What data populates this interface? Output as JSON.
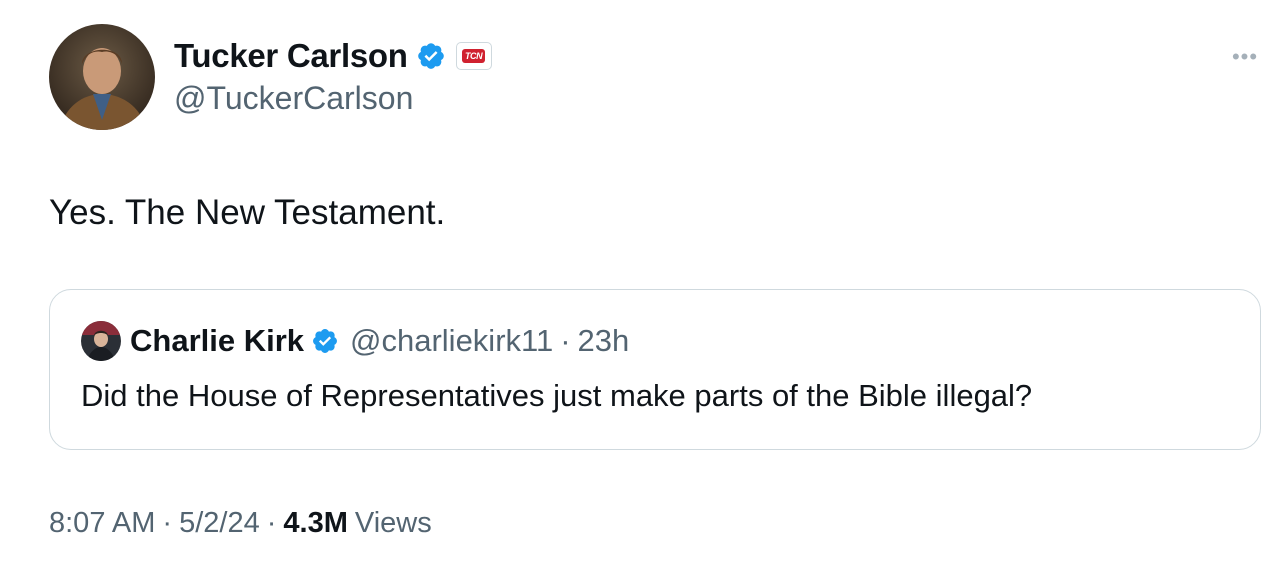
{
  "tweet": {
    "author": {
      "display_name": "Tucker Carlson",
      "handle": "@TuckerCarlson",
      "verified": true,
      "affiliation_badge": "TCN"
    },
    "more_icon": "more-horizontal-icon",
    "text": "Yes. The New Testament.",
    "quoted": {
      "display_name": "Charlie Kirk",
      "handle": "@charliekirk11",
      "separator": "·",
      "time": "23h",
      "verified": true,
      "text": "Did the House of Representatives just make parts of the Bible illegal?"
    },
    "meta": {
      "time": "8:07 AM",
      "sep1": "·",
      "date": "5/2/24",
      "sep2": "·",
      "views_count": "4.3M",
      "views_label": "Views"
    }
  },
  "colors": {
    "text_primary": "#0f1419",
    "text_secondary": "#536471",
    "verified_blue": "#1d9bf0",
    "border": "#cfd9de",
    "affiliation_red": "#d0212f"
  }
}
